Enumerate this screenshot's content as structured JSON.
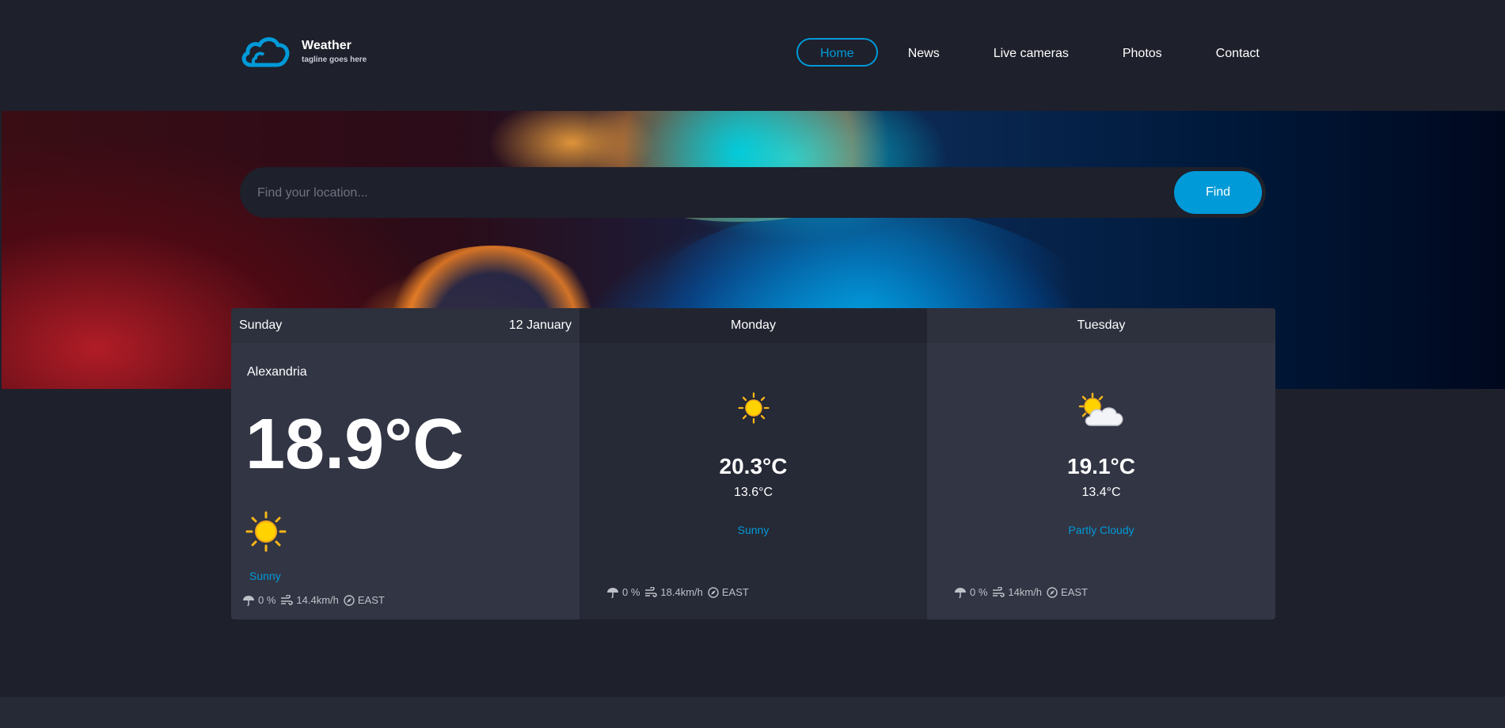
{
  "brand": {
    "title": "Weather",
    "tagline": "tagline goes here"
  },
  "nav": [
    {
      "label": "Home",
      "active": true
    },
    {
      "label": "News"
    },
    {
      "label": "Live cameras"
    },
    {
      "label": "Photos"
    },
    {
      "label": "Contact"
    }
  ],
  "search": {
    "placeholder": "Find your location...",
    "button": "Find"
  },
  "today": {
    "day": "Sunday",
    "date": "12 January",
    "location": "Alexandria",
    "temp": "18.9°C",
    "icon": "sun-icon",
    "description": "Sunny",
    "rain": "0 %",
    "wind": "14.4km/h",
    "direction": "EAST"
  },
  "forecast": [
    {
      "day": "Monday",
      "icon": "sun-icon",
      "max": "20.3°C",
      "min": "13.6°C",
      "description": "Sunny",
      "rain": "0 %",
      "wind": "18.4km/h",
      "direction": "EAST"
    },
    {
      "day": "Tuesday",
      "icon": "partly-cloudy-icon",
      "max": "19.1°C",
      "min": "13.4°C",
      "description": "Partly Cloudy",
      "rain": "0 %",
      "wind": "14km/h",
      "direction": "EAST"
    }
  ],
  "colors": {
    "accent": "#009ad8",
    "background": "#1e202b",
    "card": "#323544",
    "card_alt": "#262936"
  }
}
